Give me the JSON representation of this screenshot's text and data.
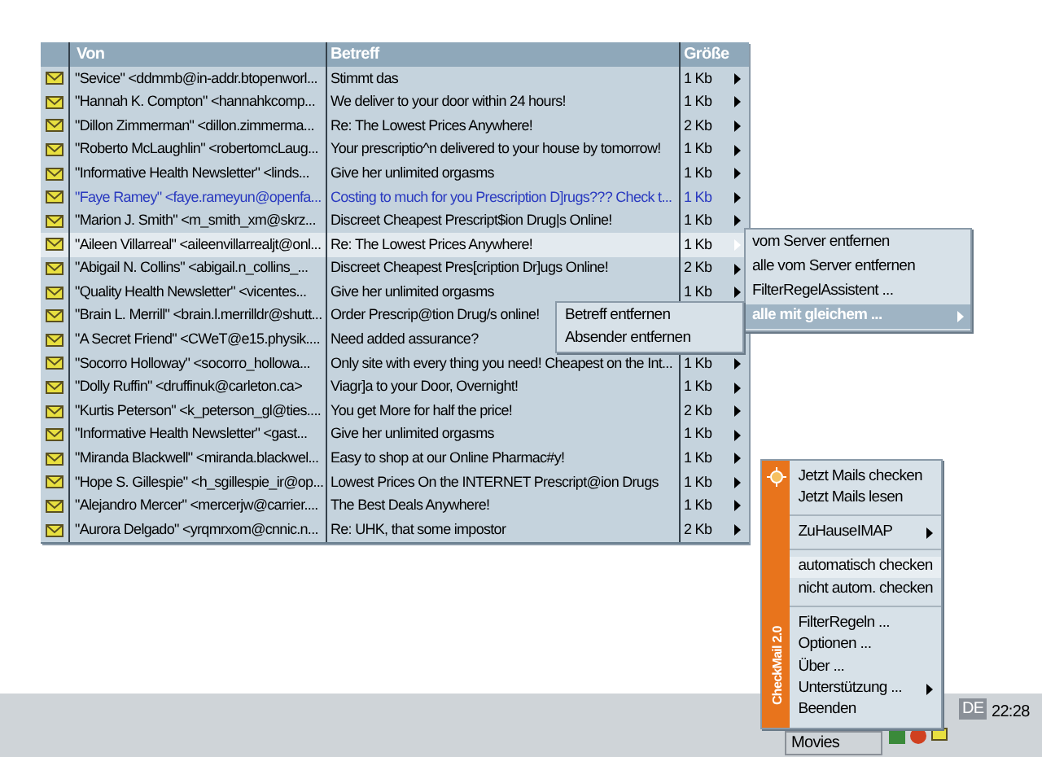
{
  "table": {
    "columns": [
      "Von",
      "Betreff",
      "Größe"
    ],
    "rows": [
      {
        "from": "\"Sevice\" <ddmmb@in-addr.btopenworl...",
        "subject": "Stimmt das",
        "size": "1 Kb",
        "selected": false,
        "unread": false
      },
      {
        "from": "\"Hannah K. Compton\" <hannahkcomp...",
        "subject": "We deliver to your door within 24 hours!",
        "size": "1 Kb",
        "selected": false,
        "unread": false
      },
      {
        "from": "\"Dillon Zimmerman\" <dillon.zimmerma...",
        "subject": "Re: The Lowest Prices Anywhere!",
        "size": "2 Kb",
        "selected": false,
        "unread": false
      },
      {
        "from": "\"Roberto McLaughlin\" <robertomcLaug...",
        "subject": "Your prescriptio^n delivered to your house by tomorrow!",
        "size": "1 Kb",
        "selected": false,
        "unread": false
      },
      {
        "from": "\"Informative Health Newsletter\" <linds...",
        "subject": "Give her unlimited orgasms",
        "size": "1 Kb",
        "selected": false,
        "unread": false
      },
      {
        "from": "\"Faye Ramey\" <faye.rameyun@openfa...",
        "subject": "Costing to much for you Prescription D]rugs??? Check t...",
        "size": "1 Kb",
        "selected": false,
        "unread": true
      },
      {
        "from": "\"Marion J. Smith\" <m_smith_xm@skrz...",
        "subject": "Discreet Cheapest Prescript$ion Drug|s Online!",
        "size": "1 Kb",
        "selected": false,
        "unread": false
      },
      {
        "from": "\"Aileen Villarreal\" <aileenvillarrealjt@onl...",
        "subject": "Re: The Lowest Prices Anywhere!",
        "size": "1 Kb",
        "selected": true,
        "unread": false
      },
      {
        "from": "\"Abigail N. Collins\" <abigail.n_collins_...",
        "subject": "Discreet Cheapest Pres[cription Dr]ugs Online!",
        "size": "2 Kb",
        "selected": false,
        "unread": false
      },
      {
        "from": "\"Quality Health Newsletter\" <vicentes...",
        "subject": "Give her unlimited orgasms",
        "size": "1 Kb",
        "selected": false,
        "unread": false
      },
      {
        "from": "\"Brain L. Merrill\" <brain.l.merrilldr@shutt...",
        "subject": "Order Prescrip@tion Drug/s online!",
        "size": "",
        "selected": false,
        "unread": false
      },
      {
        "from": "\"A Secret Friend\" <CWeT@e15.physik....",
        "subject": "Need added assurance?",
        "size": "",
        "selected": false,
        "unread": false
      },
      {
        "from": "\"Socorro Holloway\" <socorro_hollowa...",
        "subject": "Only site with every thing you need! Cheapest on the Int...",
        "size": "1 Kb",
        "selected": false,
        "unread": false
      },
      {
        "from": "\"Dolly Ruffin\" <druffinuk@carleton.ca>",
        "subject": "Viagr]a to your Door, Overnight!",
        "size": "1 Kb",
        "selected": false,
        "unread": false
      },
      {
        "from": "\"Kurtis Peterson\" <k_peterson_gl@ties....",
        "subject": "You get More for half the price!",
        "size": "2 Kb",
        "selected": false,
        "unread": false
      },
      {
        "from": "\"Informative Health Newsletter\" <gast...",
        "subject": "Give her unlimited orgasms",
        "size": "1 Kb",
        "selected": false,
        "unread": false
      },
      {
        "from": "\"Miranda Blackwell\" <miranda.blackwel...",
        "subject": "Easy to shop at our Online Pharmac#y!",
        "size": "1 Kb",
        "selected": false,
        "unread": false
      },
      {
        "from": "\"Hope S. Gillespie\" <h_sgillespie_ir@op...",
        "subject": "Lowest Prices On the INTERNET Prescript@ion Drugs",
        "size": "1 Kb",
        "selected": false,
        "unread": false
      },
      {
        "from": "\"Alejandro Mercer\" <mercerjw@carrier....",
        "subject": "The Best Deals Anywhere!",
        "size": "1 Kb",
        "selected": false,
        "unread": false
      },
      {
        "from": "\"Aurora Delgado\" <yrqmrxom@cnnic.n...",
        "subject": "Re: UHK, that some impostor",
        "size": "2 Kb",
        "selected": false,
        "unread": false
      }
    ]
  },
  "context_menu": {
    "items": [
      {
        "label": "vom Server entfernen",
        "selected": false,
        "submenu": false
      },
      {
        "label": "alle vom Server entfernen",
        "selected": false,
        "submenu": false
      },
      {
        "label": "FilterRegelAssistent ...",
        "selected": false,
        "submenu": false
      },
      {
        "label": "alle mit gleichem ...",
        "selected": true,
        "submenu": true
      }
    ]
  },
  "submenu": {
    "items": [
      {
        "label": "Betreff entfernen"
      },
      {
        "label": "Absender entfernen"
      }
    ]
  },
  "tray_menu": {
    "brand": "CheckMail 2.0",
    "items": [
      {
        "kind": "item",
        "label": "Jetzt Mails checken",
        "selected": false,
        "submenu": false
      },
      {
        "kind": "item",
        "label": "Jetzt Mails lesen",
        "selected": false,
        "submenu": false
      },
      {
        "kind": "separator"
      },
      {
        "kind": "item",
        "label": "ZuHauseIMAP",
        "selected": false,
        "submenu": true
      },
      {
        "kind": "separator"
      },
      {
        "kind": "item",
        "label": "automatisch checken",
        "selected": true,
        "submenu": false
      },
      {
        "kind": "item",
        "label": "nicht autom. checken",
        "selected": false,
        "submenu": false
      },
      {
        "kind": "separator"
      },
      {
        "kind": "item",
        "label": "FilterRegeln ...",
        "selected": false,
        "submenu": false
      },
      {
        "kind": "item",
        "label": "Optionen ...",
        "selected": false,
        "submenu": false
      },
      {
        "kind": "item",
        "label": "Über ...",
        "selected": false,
        "submenu": false
      },
      {
        "kind": "item",
        "label": "Unterstützung ...",
        "selected": false,
        "submenu": true
      },
      {
        "kind": "item",
        "label": "Beenden",
        "selected": false,
        "submenu": false
      }
    ]
  },
  "taskbar": {
    "button": "Movies",
    "language": "DE",
    "clock": "22:28"
  }
}
